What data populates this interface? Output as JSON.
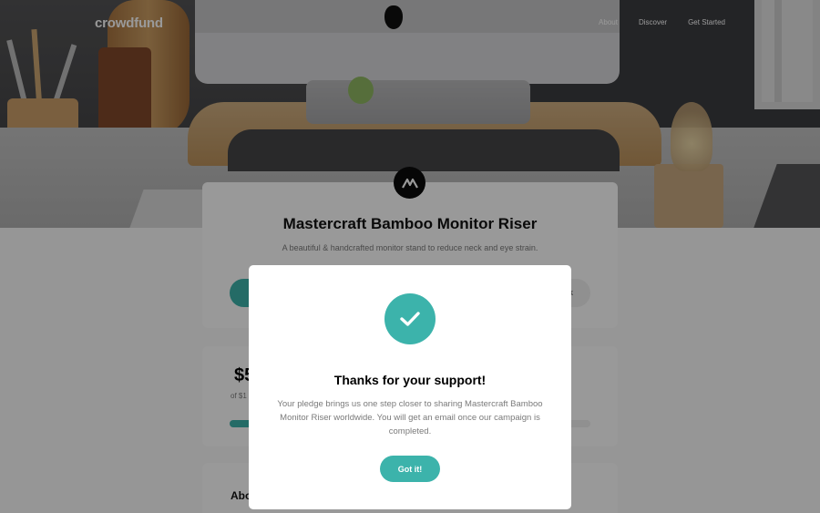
{
  "header": {
    "logo": "crowdfund",
    "nav": [
      "About",
      "Discover",
      "Get Started"
    ]
  },
  "project": {
    "title": "Mastercraft Bamboo Monitor Riser",
    "subtitle": "A beautiful & handcrafted monitor stand to reduce neck and eye strain.",
    "bookmark_label_visible": "k",
    "amount_visible": "$5",
    "of_label_visible": "of $1",
    "about_label_visible": "Abo"
  },
  "modal": {
    "title": "Thanks for your support!",
    "body": "Your pledge brings us one step closer to sharing Mastercraft Bamboo Monitor Riser worldwide. You will get an email once our campaign is completed.",
    "button": "Got it!"
  },
  "colors": {
    "accent": "#3cb3ab",
    "overlay": "rgba(0,0,0,0.4)"
  },
  "icons": {
    "brand": "mastercraft-logo-icon",
    "success": "check-icon"
  }
}
